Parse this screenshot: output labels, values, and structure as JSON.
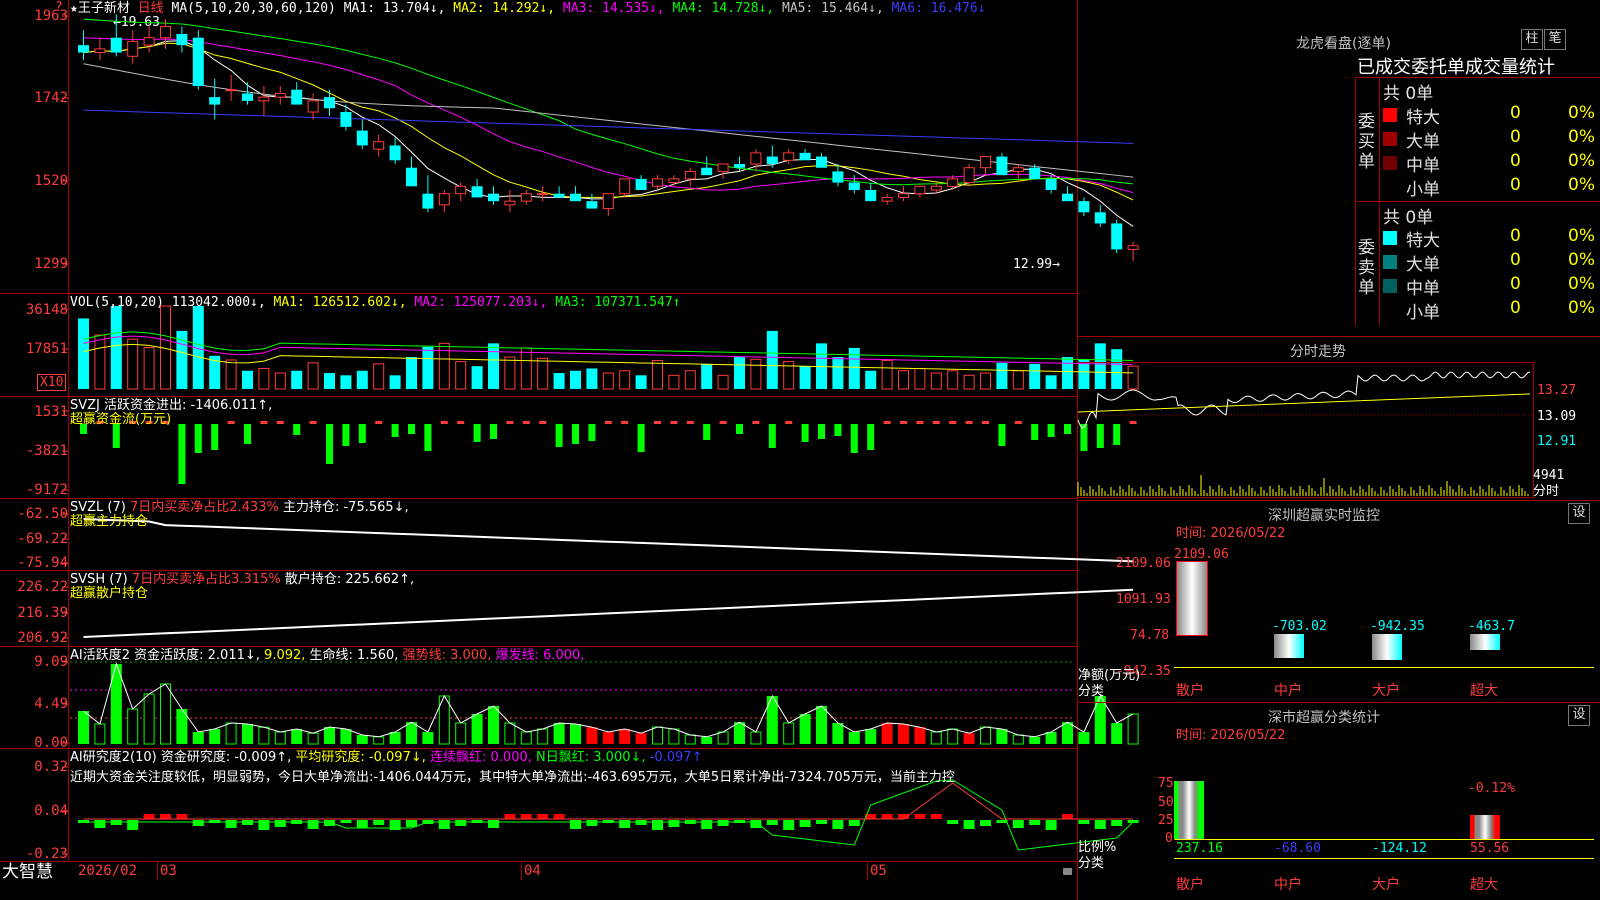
{
  "stock": {
    "name": "王子新材",
    "star": "★",
    "period": "日线",
    "ma_params": "MA(5,10,20,30,60,120)",
    "ma1": "MA1: 13.704↓,",
    "ma2": "MA2: 14.292↓,",
    "ma3": "MA3: 14.535↓,",
    "ma4": "MA4: 14.728↓,",
    "ma5": "MA5: 15.464↓,",
    "ma6": "MA6: 16.476↓",
    "high_note": "←19.63",
    "low_note": "12.99→",
    "corner": "?",
    "y_labels": [
      "1963",
      "1742",
      "1520",
      "1299"
    ]
  },
  "volume": {
    "header": "VOL(5,10,20)",
    "value": "113042.000↓,",
    "ma1": "MA1: 126512.602↓,",
    "ma2": "MA2: 125077.203↓,",
    "ma3": "MA3: 107371.547↑",
    "y_labels": [
      "36148",
      "17851"
    ],
    "unit": "X10"
  },
  "svzj": {
    "header": "SVZJ  活跃资金进出: -1406.011↑,",
    "sub": "超赢资金流(万元)",
    "y_labels": [
      "1531",
      "-3821",
      "-9172"
    ]
  },
  "svzl": {
    "header": "SVZL (7)",
    "ratio": "7日内买卖净占比2.433%",
    "hold": "主力持仓: -75.565↓,",
    "sub": "超赢主力持仓",
    "y_labels": [
      "-62.50",
      "-69.22",
      "-75.94"
    ]
  },
  "svsh": {
    "header": "SVSH (7)",
    "ratio": "7日内买卖净占比3.315%",
    "hold": "散户持仓: 225.662↑,",
    "sub": "超赢散户持仓",
    "y_labels": [
      "226.22",
      "216.39",
      "206.92"
    ]
  },
  "ai_active": {
    "header": "AI活跃度2",
    "fund": "资金活跃度: 2.011↓,",
    "val2": "9.092,",
    "life": "生命线: 1.560,",
    "strong": "强势线: 3.000,",
    "burst": "爆发线: 6.000,",
    "y_labels": [
      "9.09",
      "4.49",
      "0.00"
    ]
  },
  "ai_research": {
    "header": "AI研究度2(10)",
    "fund": "资金研究度: -0.009↑,",
    "avg": "平均研究度: -0.097↓,",
    "cont": "连续飘红: 0.000,",
    "nday": "N日飘红: 3.000↓,",
    "last": "-0.097↑",
    "commentary": "近期大资金关注度较低，明显弱势，今日大单净流出:-1406.044万元，其中特大单净流出:-463.695万元，大单5日累计净出-7324.705万元，当前主力控",
    "y_labels": [
      "0.32",
      "0.04",
      "-0.23"
    ]
  },
  "bottom_bar": {
    "brand": "大智慧",
    "dates": [
      "2026/02",
      "03",
      "04",
      "05"
    ]
  },
  "dragon_tiger": {
    "title": "龙虎看盘(逐单)",
    "btn_bar": "柱",
    "btn_pen": "笔",
    "subtitle": "已成交委托单成交量统计",
    "buy_label": "委买单",
    "sell_label": "委卖单",
    "buy_total": "共 0单",
    "sell_total": "共 0单",
    "buy_rows": [
      {
        "label": "特大",
        "count": "0",
        "pct": "0%",
        "color": "#ff0000"
      },
      {
        "label": "大单",
        "count": "0",
        "pct": "0%",
        "color": "#a00000"
      },
      {
        "label": "中单",
        "count": "0",
        "pct": "0%",
        "color": "#700000"
      },
      {
        "label": "小单",
        "count": "0",
        "pct": "0%",
        "color": "#000000"
      }
    ],
    "sell_rows": [
      {
        "label": "特大",
        "count": "0",
        "pct": "0%",
        "color": "#00ffff"
      },
      {
        "label": "大单",
        "count": "0",
        "pct": "0%",
        "color": "#008080"
      },
      {
        "label": "中单",
        "count": "0",
        "pct": "0%",
        "color": "#006060"
      },
      {
        "label": "小单",
        "count": "0",
        "pct": "0%",
        "color": "#000000"
      }
    ]
  },
  "intraday": {
    "title": "分时走势",
    "prices": [
      "13.27",
      "13.09",
      "12.91"
    ],
    "volume": "4941",
    "unit": "分时"
  },
  "realtime_monitor": {
    "title": "深圳超赢实时监控",
    "btn": "设",
    "time": "时间: 2026/05/22",
    "y_labels": [
      "2109.06",
      "1091.93",
      "74.78",
      "-942.35"
    ],
    "y_axis_label": "净额(万元)",
    "x_axis_label": "分类",
    "categories": [
      "散户",
      "中户",
      "大户",
      "超大"
    ],
    "values": [
      2109.06,
      -703.02,
      -942.35,
      -463.7
    ],
    "value_labels": [
      "2109.06",
      "-703.02",
      "-942.35",
      "-463.7"
    ]
  },
  "classification": {
    "title": "深市超赢分类统计",
    "btn": "设",
    "time": "时间: 2026/05/22",
    "y_labels": [
      "75",
      "50",
      "25",
      "0"
    ],
    "y_axis_label": "比例%",
    "x_axis_label": "分类",
    "categories": [
      "散户",
      "中户",
      "大户",
      "超大"
    ],
    "value_labels": [
      "237.16",
      "-68.60",
      "-124.12",
      "55.56"
    ],
    "top_label": "-0.12%"
  },
  "colors": {
    "up": "#ff3c3c",
    "down": "#00ffff",
    "frame": "#a00000",
    "ma1": "#ffffff",
    "ma2": "#ffff00",
    "ma3": "#ff00ff",
    "ma4": "#00ff00",
    "ma5": "#c0c0c0",
    "ma6": "#3c3cff"
  },
  "chart_data": {
    "type": "candlestick",
    "title": "王子新材 日线",
    "ylim": [
      12.99,
      19.63
    ],
    "candles_ohlc": [
      [
        18.8,
        19.2,
        18.4,
        18.6
      ],
      [
        18.6,
        19.0,
        18.4,
        18.7
      ],
      [
        19.0,
        19.63,
        18.5,
        18.6
      ],
      [
        18.5,
        19.2,
        18.3,
        18.9
      ],
      [
        18.8,
        19.3,
        18.6,
        19.0
      ],
      [
        19.0,
        19.5,
        18.7,
        19.3
      ],
      [
        19.1,
        19.3,
        18.6,
        18.8
      ],
      [
        19.0,
        19.2,
        17.6,
        17.7
      ],
      [
        17.4,
        17.9,
        16.8,
        17.2
      ],
      [
        17.6,
        18.0,
        17.3,
        17.6
      ],
      [
        17.5,
        17.8,
        17.2,
        17.3
      ],
      [
        17.3,
        17.7,
        16.9,
        17.4
      ],
      [
        17.4,
        17.7,
        17.2,
        17.5
      ],
      [
        17.6,
        17.8,
        17.2,
        17.2
      ],
      [
        17.0,
        17.5,
        16.8,
        17.3
      ],
      [
        17.4,
        17.6,
        16.9,
        17.1
      ],
      [
        17.0,
        17.2,
        16.5,
        16.6
      ],
      [
        16.5,
        16.8,
        16.0,
        16.1
      ],
      [
        16.0,
        16.4,
        15.8,
        16.2
      ],
      [
        16.1,
        16.3,
        15.6,
        15.7
      ],
      [
        15.5,
        15.8,
        15.0,
        15.0
      ],
      [
        14.8,
        15.3,
        14.3,
        14.4
      ],
      [
        14.5,
        14.9,
        14.3,
        14.8
      ],
      [
        14.8,
        15.1,
        14.6,
        15.0
      ],
      [
        15.0,
        15.2,
        14.7,
        14.7
      ],
      [
        14.8,
        15.0,
        14.5,
        14.6
      ],
      [
        14.5,
        14.9,
        14.3,
        14.6
      ],
      [
        14.6,
        14.9,
        14.5,
        14.8
      ],
      [
        14.8,
        15.0,
        14.6,
        14.8
      ],
      [
        14.8,
        15.0,
        14.7,
        14.7
      ],
      [
        14.8,
        15.0,
        14.6,
        14.6
      ],
      [
        14.6,
        14.8,
        14.4,
        14.4
      ],
      [
        14.4,
        14.8,
        14.2,
        14.8
      ],
      [
        14.8,
        15.2,
        14.7,
        15.2
      ],
      [
        15.2,
        15.3,
        14.9,
        14.9
      ],
      [
        15.0,
        15.3,
        14.9,
        15.2
      ],
      [
        15.1,
        15.3,
        15.0,
        15.2
      ],
      [
        15.2,
        15.5,
        15.0,
        15.4
      ],
      [
        15.5,
        15.8,
        15.3,
        15.3
      ],
      [
        15.4,
        15.6,
        15.2,
        15.6
      ],
      [
        15.6,
        15.8,
        15.4,
        15.5
      ],
      [
        15.6,
        16.0,
        15.4,
        15.9
      ],
      [
        15.8,
        16.1,
        15.5,
        15.6
      ],
      [
        15.7,
        16.0,
        15.6,
        15.9
      ],
      [
        15.9,
        16.0,
        15.7,
        15.7
      ],
      [
        15.8,
        15.9,
        15.5,
        15.5
      ],
      [
        15.4,
        15.6,
        15.0,
        15.1
      ],
      [
        15.1,
        15.3,
        14.8,
        14.9
      ],
      [
        14.9,
        15.1,
        14.6,
        14.6
      ],
      [
        14.6,
        14.8,
        14.5,
        14.7
      ],
      [
        14.7,
        15.0,
        14.6,
        14.8
      ],
      [
        14.8,
        15.0,
        14.7,
        15.0
      ],
      [
        14.9,
        15.1,
        14.8,
        15.0
      ],
      [
        15.0,
        15.3,
        14.9,
        15.2
      ],
      [
        15.1,
        15.6,
        15.0,
        15.5
      ],
      [
        15.5,
        15.8,
        15.3,
        15.8
      ],
      [
        15.8,
        15.9,
        15.3,
        15.3
      ],
      [
        15.4,
        15.6,
        15.2,
        15.5
      ],
      [
        15.5,
        15.6,
        15.2,
        15.2
      ],
      [
        15.2,
        15.3,
        14.8,
        14.9
      ],
      [
        14.8,
        15.0,
        14.6,
        14.6
      ],
      [
        14.6,
        14.7,
        14.2,
        14.3
      ],
      [
        14.3,
        14.5,
        13.9,
        14.0
      ],
      [
        14.0,
        14.1,
        13.2,
        13.3
      ],
      [
        13.3,
        13.5,
        12.99,
        13.4
      ]
    ]
  }
}
